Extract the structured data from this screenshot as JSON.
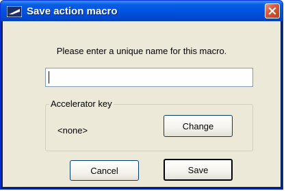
{
  "dialog": {
    "title": "Save action macro",
    "title_icon": "macro-app-icon",
    "close_icon": "close-icon",
    "prompt": "Please enter a unique name for this macro.",
    "name_field": {
      "value": "",
      "placeholder": ""
    },
    "accelerator_group": {
      "label": "Accelerator key",
      "value": "<none>",
      "change_label": "Change"
    },
    "buttons": {
      "cancel_label": "Cancel",
      "save_label": "Save"
    }
  },
  "colors": {
    "titlebar": "#0054e3",
    "close_button": "#d8593a",
    "dialog_background": "#ece9d8",
    "input_border": "#7f9db9"
  }
}
